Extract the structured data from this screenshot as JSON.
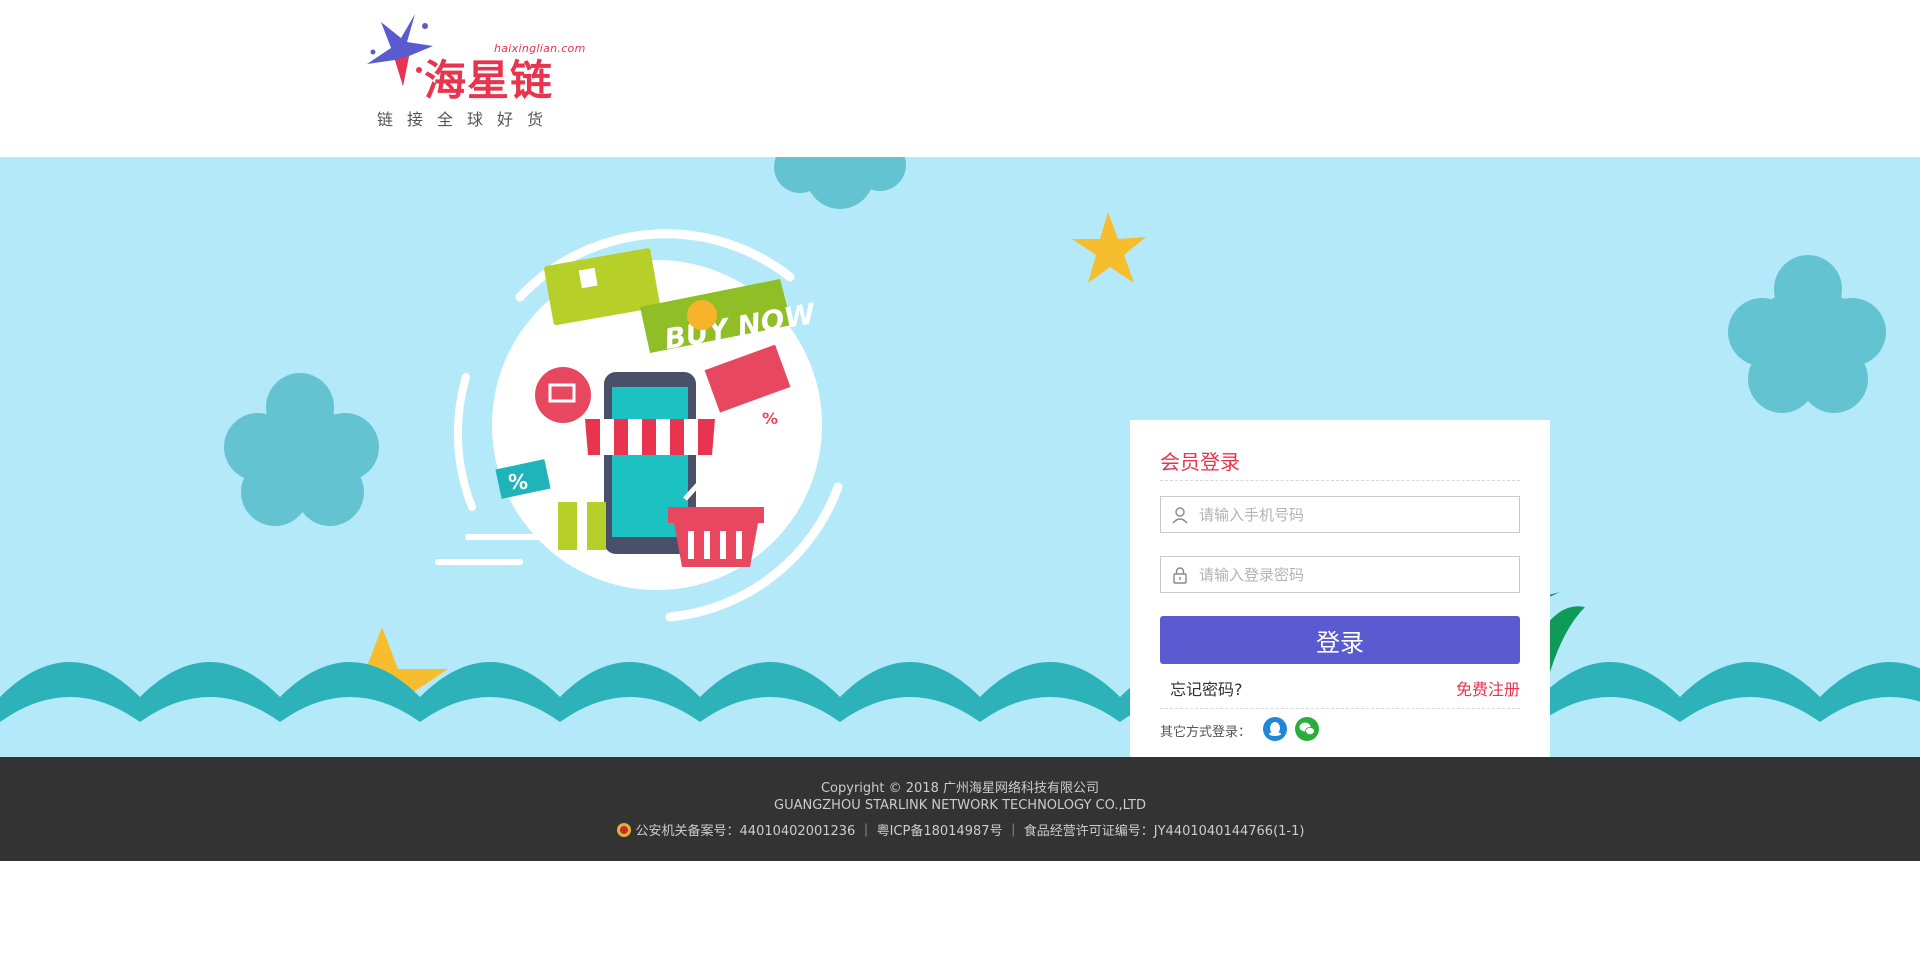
{
  "header": {
    "logo_domain": "haixinglian.com",
    "logo_title": "海星链",
    "logo_slogan": "链接全球好货"
  },
  "banner": {
    "promo_text": "BUY NOW",
    "promo_percent": "%"
  },
  "login": {
    "title": "会员登录",
    "phone_placeholder": "请输入手机号码",
    "password_placeholder": "请输入登录密码",
    "submit_label": "登录",
    "forgot_label": "忘记密码?",
    "register_label": "免费注册",
    "other_methods_label": "其它方式登录："
  },
  "footer": {
    "copyright": "Copyright © 2018 广州海星网络科技有限公司",
    "company_en": "GUANGZHOU STARLINK NETWORK TECHNOLOGY CO.,LTD",
    "registration": "公安机关备案号：44010402001236 ｜ 粤ICP备18014987号 ｜ 食品经营许可证编号：JY4401040144766(1-1)"
  },
  "colors": {
    "brand_red": "#e8344e",
    "button_blue": "#5a5bd0",
    "banner_bg": "#b4e9fa",
    "footer_bg": "#333333"
  },
  "icons": [
    "logo-star-icon",
    "user-icon",
    "lock-icon",
    "qq-icon",
    "wechat-icon",
    "police-badge-icon"
  ]
}
